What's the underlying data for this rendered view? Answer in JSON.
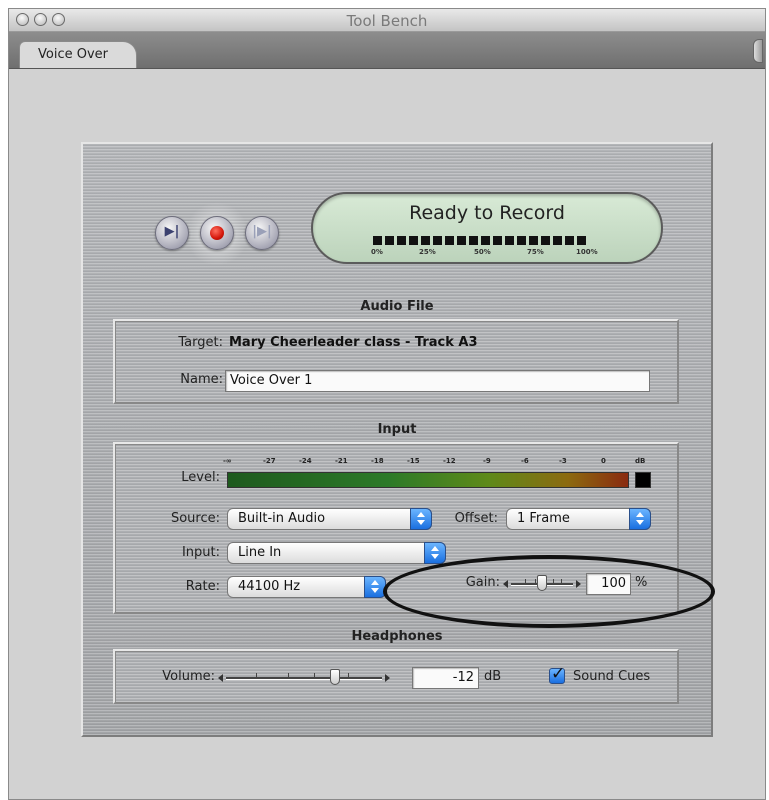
{
  "window": {
    "title": "Tool Bench"
  },
  "tabs": [
    {
      "label": "Voice Over"
    }
  ],
  "transport": {
    "review_icon": "review-record-icon",
    "record_icon": "record-icon",
    "discard_icon": "discard-icon"
  },
  "status": {
    "text": "Ready to Record",
    "progress_labels": [
      "0%",
      "25%",
      "50%",
      "75%",
      "100%"
    ]
  },
  "audio_file": {
    "title": "Audio File",
    "target_label": "Target:",
    "target_value": "Mary Cheerleader class - Track A3",
    "name_label": "Name:",
    "name_value": "Voice Over 1"
  },
  "input": {
    "title": "Input",
    "level_label": "Level:",
    "meter_ticks": [
      "-∞",
      "-27",
      "-24",
      "-21",
      "-18",
      "-15",
      "-12",
      "-9",
      "-6",
      "-3",
      "0",
      "dB"
    ],
    "source_label": "Source:",
    "source_value": "Built-in Audio",
    "offset_label": "Offset:",
    "offset_value": "1 Frame",
    "input_label": "Input:",
    "input_value": "Line In",
    "rate_label": "Rate:",
    "rate_value": "44100 Hz",
    "gain_label": "Gain:",
    "gain_value": "100",
    "gain_unit": "%"
  },
  "headphones": {
    "title": "Headphones",
    "volume_label": "Volume:",
    "volume_value": "-12",
    "volume_unit": "dB",
    "sound_cues_label": "Sound Cues",
    "sound_cues_checked": true
  },
  "colors": {
    "record_red": "#d4160a",
    "popup_blue": "#1a6fe0",
    "status_green": "#c8dec6",
    "annotation_ellipse": "#111111"
  }
}
